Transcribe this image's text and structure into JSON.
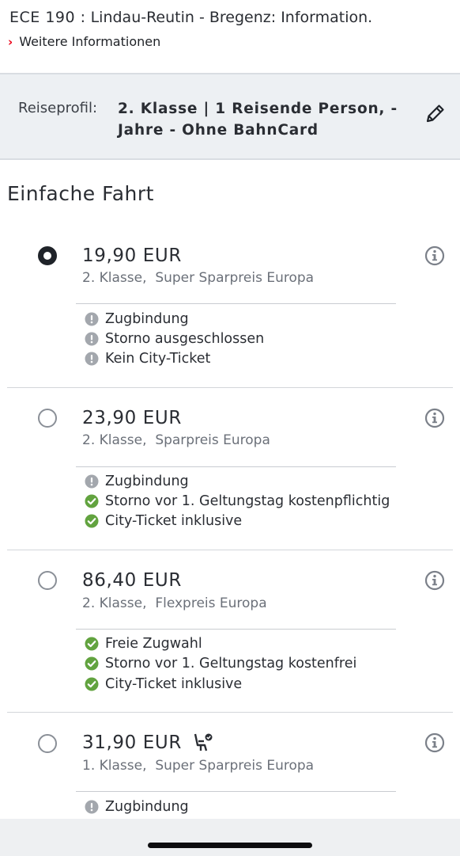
{
  "header": {
    "train_id": "ECE 190 :",
    "route": "Lindau-Reutin - Bregenz: Information.",
    "more_link": "Weitere Informationen"
  },
  "profile": {
    "label": "Reiseprofil:",
    "value_line1": "2. Klasse | 1 Reisende Person, -",
    "value_line2": "Jahre - Ohne BahnCard",
    "edit_icon": "pencil-icon"
  },
  "section_title": "Einfache Fahrt",
  "colors": {
    "accent_red": "#ec0016",
    "check_green": "#62a33f",
    "warning_gray": "#a3a7ad",
    "text": "#2a2d33",
    "profile_bg": "#edf0f3"
  },
  "offers": [
    {
      "selected": true,
      "price": "19,90 EUR",
      "class": "2. Klasse,",
      "fare": "Super Sparpreis Europa",
      "features": [
        {
          "icon": "warning-icon",
          "text": "Zugbindung"
        },
        {
          "icon": "warning-icon",
          "text": "Storno ausgeschlossen"
        },
        {
          "icon": "warning-icon",
          "text": "Kein City-Ticket"
        }
      ]
    },
    {
      "selected": false,
      "price": "23,90 EUR",
      "class": "2. Klasse,",
      "fare": "Sparpreis Europa",
      "features": [
        {
          "icon": "warning-icon",
          "text": "Zugbindung"
        },
        {
          "icon": "check-icon",
          "text": "Storno vor 1. Geltungstag kostenpflichtig"
        },
        {
          "icon": "check-icon",
          "text": "City-Ticket inklusive"
        }
      ]
    },
    {
      "selected": false,
      "price": "86,40 EUR",
      "class": "2. Klasse,",
      "fare": "Flexpreis Europa",
      "features": [
        {
          "icon": "check-icon",
          "text": "Freie Zugwahl"
        },
        {
          "icon": "check-icon",
          "text": "Storno vor 1. Geltungstag kostenfrei"
        },
        {
          "icon": "check-icon",
          "text": "City-Ticket inklusive"
        }
      ]
    },
    {
      "selected": false,
      "price": "31,90 EUR",
      "class": "1. Klasse,",
      "fare": "Super Sparpreis Europa",
      "badge_icon": "seat-reservation-icon",
      "features": [
        {
          "icon": "warning-icon",
          "text": "Zugbindung"
        }
      ]
    }
  ]
}
